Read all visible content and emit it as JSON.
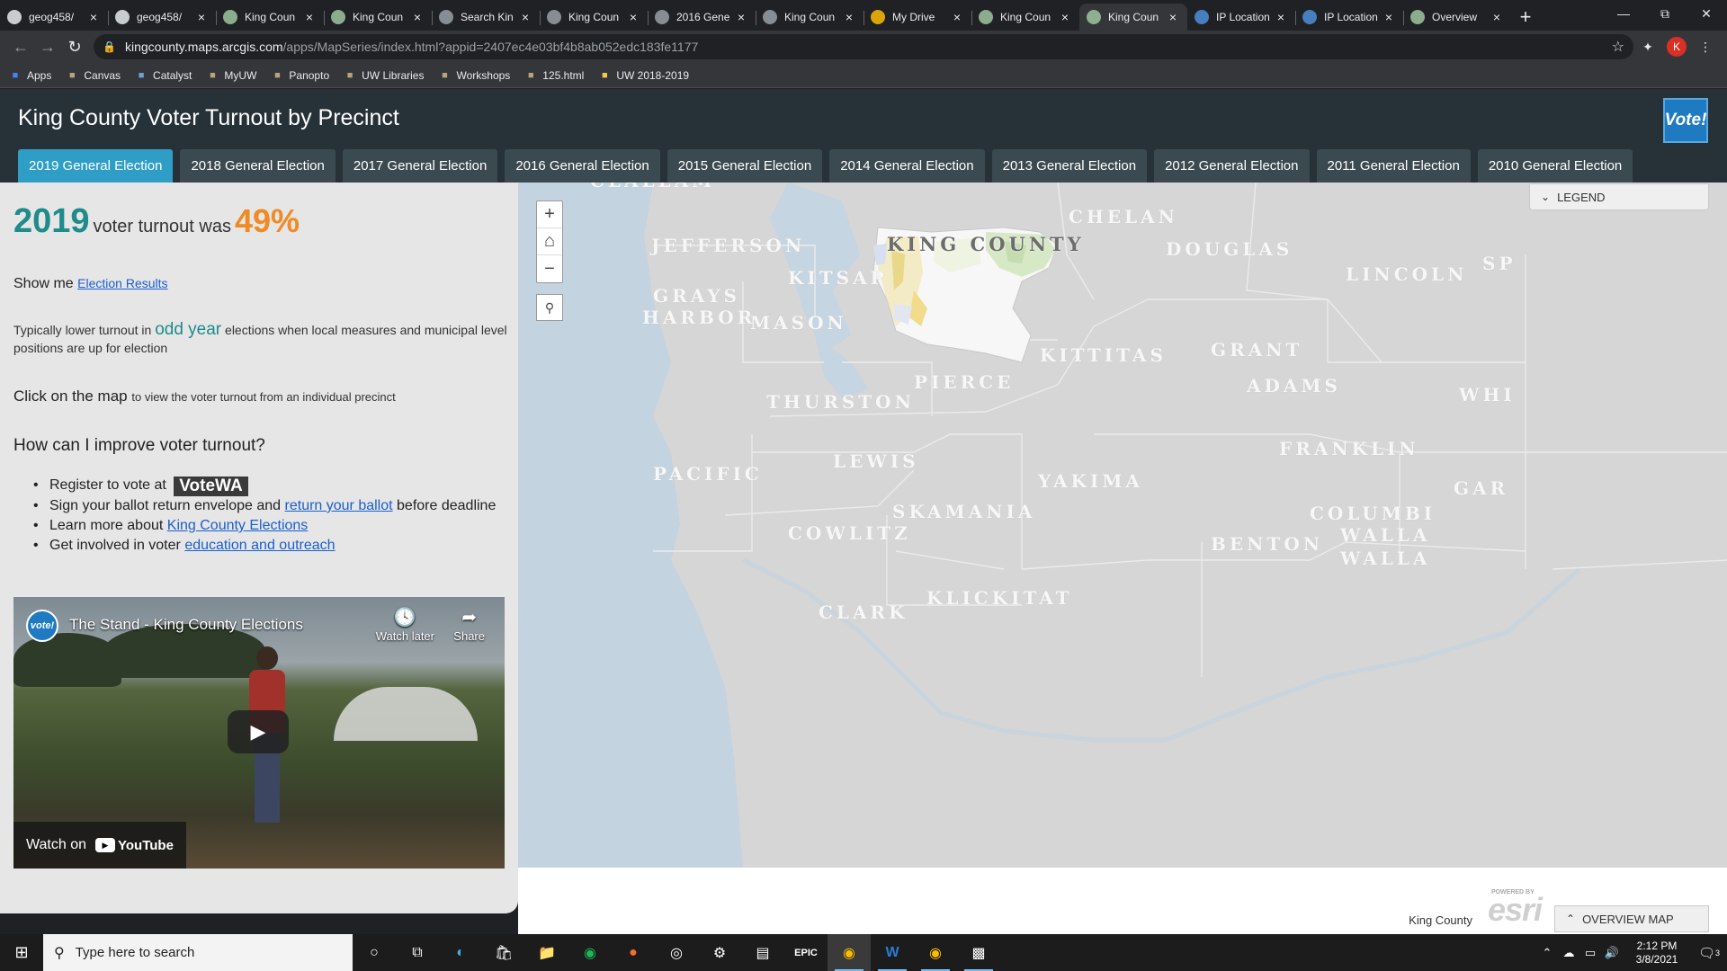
{
  "browser": {
    "tabs": [
      {
        "title": "geog458/",
        "icon": "github-icon",
        "color": "#e8eaed"
      },
      {
        "title": "geog458/",
        "icon": "github-icon",
        "color": "#e8eaed"
      },
      {
        "title": "King Coun",
        "icon": "arcgis-globe-icon",
        "color": "#9fc6a0"
      },
      {
        "title": "King Coun",
        "icon": "arcgis-globe-icon",
        "color": "#9fc6a0"
      },
      {
        "title": "Search Kin",
        "icon": "blank-page-icon",
        "color": "#9aa0a6"
      },
      {
        "title": "King Coun",
        "icon": "blank-page-icon",
        "color": "#9aa0a6"
      },
      {
        "title": "2016 Gene",
        "icon": "blank-page-icon",
        "color": "#9aa0a6"
      },
      {
        "title": "King Coun",
        "icon": "blank-page-icon",
        "color": "#9aa0a6"
      },
      {
        "title": "My Drive",
        "icon": "google-drive-icon",
        "color": "#fbbc04"
      },
      {
        "title": "King Coun",
        "icon": "arcgis-globe-icon",
        "color": "#9fc6a0"
      },
      {
        "title": "King Coun",
        "icon": "arcgis-globe-icon",
        "color": "#9fc6a0",
        "active": true
      },
      {
        "title": "IP Location",
        "icon": "ip-location-icon",
        "color": "#4f8ed8"
      },
      {
        "title": "IP Location",
        "icon": "ip-location-icon",
        "color": "#4f8ed8"
      },
      {
        "title": "Overview",
        "icon": "arcgis-globe-icon",
        "color": "#9fc6a0"
      }
    ],
    "url_host": "kingcounty.maps.arcgis.com",
    "url_path": "/apps/MapSeries/index.html?appid=2407ec4e03bf4b8ab052edc183fe1177",
    "profile_initial": "K",
    "bookmarks": [
      {
        "label": "Apps",
        "icon": "apps-grid-icon",
        "color": "#4285f4"
      },
      {
        "label": "Canvas",
        "icon": "uw-w-icon",
        "color": "#b7a57a"
      },
      {
        "label": "Catalyst",
        "icon": "catalyst-icon",
        "color": "#6ea1d8"
      },
      {
        "label": "MyUW",
        "icon": "myuw-icon",
        "color": "#b7a57a"
      },
      {
        "label": "Panopto",
        "icon": "uw-w-icon",
        "color": "#b7a57a"
      },
      {
        "label": "UW Libraries",
        "icon": "uw-w-icon",
        "color": "#b7a57a"
      },
      {
        "label": "Workshops",
        "icon": "uw-w-icon",
        "color": "#b7a57a"
      },
      {
        "label": "125.html",
        "icon": "uw-w-icon",
        "color": "#b7a57a"
      },
      {
        "label": "UW 2018-2019",
        "icon": "folder-icon",
        "color": "#f6c744"
      }
    ]
  },
  "app": {
    "title": "King County Voter Turnout by Precinct",
    "logo_text": "Vote!",
    "accent_color": "#2f9ec7",
    "tabs": [
      {
        "label": "2019 General Election",
        "active": true
      },
      {
        "label": "2018 General Election"
      },
      {
        "label": "2017 General Election"
      },
      {
        "label": "2016 General Election"
      },
      {
        "label": "2015 General Election"
      },
      {
        "label": "2014 General Election"
      },
      {
        "label": "2013 General Election"
      },
      {
        "label": "2012 General Election"
      },
      {
        "label": "2011 General Election"
      },
      {
        "label": "2010 General Election"
      }
    ]
  },
  "panel": {
    "year": "2019",
    "turnout_phrase": "voter turnout was",
    "turnout_pct": "49%",
    "show_me_label": "Show me",
    "show_me_link": "Election Results",
    "typically_pre": "Typically lower turnout in",
    "odd_year": "odd year",
    "typically_post": "elections when local measures and municipal level positions are up for election",
    "click_strong": "Click on the map",
    "click_rest": "to view the voter turnout from an individual precinct",
    "improve_heading": "How can I improve voter turnout?",
    "bullet1_text": "Register to vote at",
    "bullet1_logo": "VoteWA",
    "bullet2_pre": "Sign your ballot return envelope and",
    "bullet2_link": "return your ballot",
    "bullet2_post": "before deadline",
    "bullet3_pre": "Learn more about",
    "bullet3_link": "King County Elections",
    "bullet4_pre": "Get involved in voter",
    "bullet4_link": "education and outreach",
    "video": {
      "channel_logo": "vote!",
      "title": "The Stand - King County Elections",
      "watch_later": "Watch later",
      "share": "Share",
      "watch_on": "Watch on",
      "youtube": "YouTube"
    }
  },
  "map": {
    "counties": [
      "CLALLAM",
      "JEFFERSON",
      "CHELAN",
      "DOUGLAS",
      "LINCOLN",
      "KING COUNTY",
      "KITSAP",
      "GRAYS",
      "HARBOR",
      "MASON",
      "KITTITAS",
      "GRANT",
      "PIERCE",
      "ADAMS",
      "THURSTON",
      "FRANKLIN",
      "LEWIS",
      "PACIFIC",
      "YAKIMA",
      "SKAMANIA",
      "COWLITZ",
      "BENTON",
      "WALLA",
      "WALLA",
      "KLICKITAT",
      "CLARK",
      "COLUMBI",
      "GAR",
      "WHI",
      "SP"
    ],
    "legend_label": "LEGEND",
    "overview_label": "OVERVIEW MAP",
    "attribution": "King County",
    "esri_powered": "POWERED BY",
    "esri_word": "esri",
    "water_color": "#c3d3e0",
    "land_color": "#d6d6d6"
  },
  "taskbar": {
    "search_placeholder": "Type here to search",
    "time": "2:12 PM",
    "date": "3/8/2021",
    "notifications": "3"
  }
}
